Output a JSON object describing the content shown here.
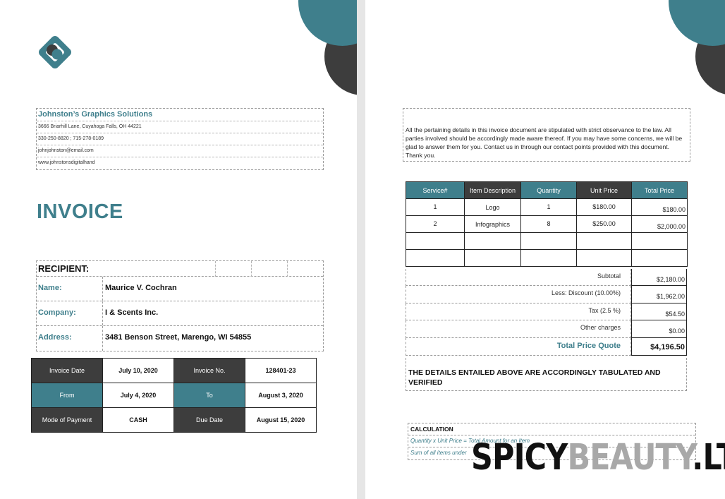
{
  "colors": {
    "teal": "#3f7f8c",
    "dark": "#3d3d3d"
  },
  "company": {
    "name": "Johnston’s Graphics Solutions",
    "address": "3666 Briarhill Lane, Cuyahoga Falls, OH 44221",
    "phone": "330-250-8820 ; 715-278-0189",
    "email": "johnjohnston@email.com",
    "website": "www.johnstonsdigitalhand"
  },
  "invoice_title": "INVOICE",
  "recipient": {
    "heading": "RECIPIENT:",
    "name_label": "Name:",
    "name": "Maurice V. Cochran",
    "company_label": "Company:",
    "company": "I & Scents Inc.",
    "address_label": "Address:",
    "address": "3481 Benson Street, Marengo, WI 54855"
  },
  "meta": {
    "invoice_date_label": "Invoice Date",
    "invoice_date": "July 10, 2020",
    "invoice_no_label": "Invoice No.",
    "invoice_no": "128401-23",
    "from_label": "From",
    "from": "July 4, 2020",
    "to_label": "To",
    "to": "August 3, 2020",
    "payment_label": "Mode of Payment",
    "payment": "CASH",
    "due_label": "Due Date",
    "due": "August 15, 2020"
  },
  "terms": "All the pertaining details in this invoice document are stipulated with strict observance to the law. All parties involved should be accordingly made aware thereof. If you may have some concerns, we will be glad to answer them for you. Contact us in through our contact points provided with this document. Thank you.",
  "items": {
    "headers": [
      "Service#",
      "Item Description",
      "Quantity",
      "Unit Price",
      "Total Price"
    ],
    "rows": [
      {
        "service": "1",
        "description": "Logo",
        "quantity": "1",
        "unit_price": "$180.00",
        "total": "$180.00"
      },
      {
        "service": "2",
        "description": "Infographics",
        "quantity": "8",
        "unit_price": "$250.00",
        "total": "$2,000.00"
      }
    ]
  },
  "summary": {
    "subtotal_label": "Subtotal",
    "subtotal": "$2,180.00",
    "discount_label": "Less: Discount (10.00%)",
    "discount": "$1,962.00",
    "tax_label": "Tax (2.5 %)",
    "tax": "$54.50",
    "other_label": "Other charges",
    "other": "$0.00",
    "total_label": "Total Price Quote",
    "total": "$4,196.50"
  },
  "verified_text": "THE DETAILS ENTAILED ABOVE ARE ACCORDINGLY TABULATED AND VERIFIED",
  "calculation": {
    "heading": "CALCULATION",
    "line1": "Quantity x Unit Price = Total Amount for an Item",
    "line2": "Sum of all items under"
  },
  "watermark": {
    "part1": "SPICY",
    "part2": "BEAUTY",
    "part3": ".LT"
  }
}
